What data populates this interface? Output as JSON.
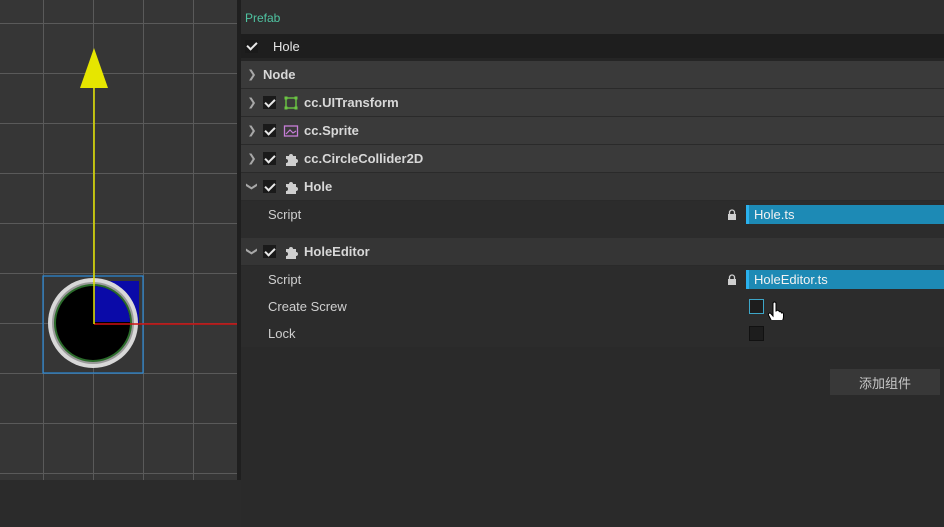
{
  "inspector": {
    "prefab_label": "Prefab",
    "node_name": "Hole",
    "node_enabled": true,
    "node_section_label": "Node",
    "add_component_label": "添加组件"
  },
  "components": [
    {
      "name": "cc.UITransform",
      "icon": "transform-icon",
      "enabled": true,
      "expanded": false
    },
    {
      "name": "cc.Sprite",
      "icon": "sprite-icon",
      "enabled": true,
      "expanded": false
    },
    {
      "name": "cc.CircleCollider2D",
      "icon": "puzzle-icon",
      "enabled": true,
      "expanded": false
    },
    {
      "name": "Hole",
      "icon": "puzzle-icon",
      "enabled": true,
      "expanded": true,
      "props": [
        {
          "label": "Script",
          "value": "Hole.ts"
        }
      ]
    },
    {
      "name": "HoleEditor",
      "icon": "puzzle-icon",
      "enabled": true,
      "expanded": true,
      "props": [
        {
          "label": "Script",
          "value": "HoleEditor.ts"
        },
        {
          "label": "Create Screw",
          "value": false
        },
        {
          "label": "Lock",
          "value": false
        }
      ]
    }
  ],
  "colors": {
    "prefab_green": "#4fc3a1",
    "asset_field": "#1d8ab5",
    "gizmo_y": "#e6e600",
    "gizmo_x": "#d01010",
    "selection": "#2a8ad8"
  }
}
